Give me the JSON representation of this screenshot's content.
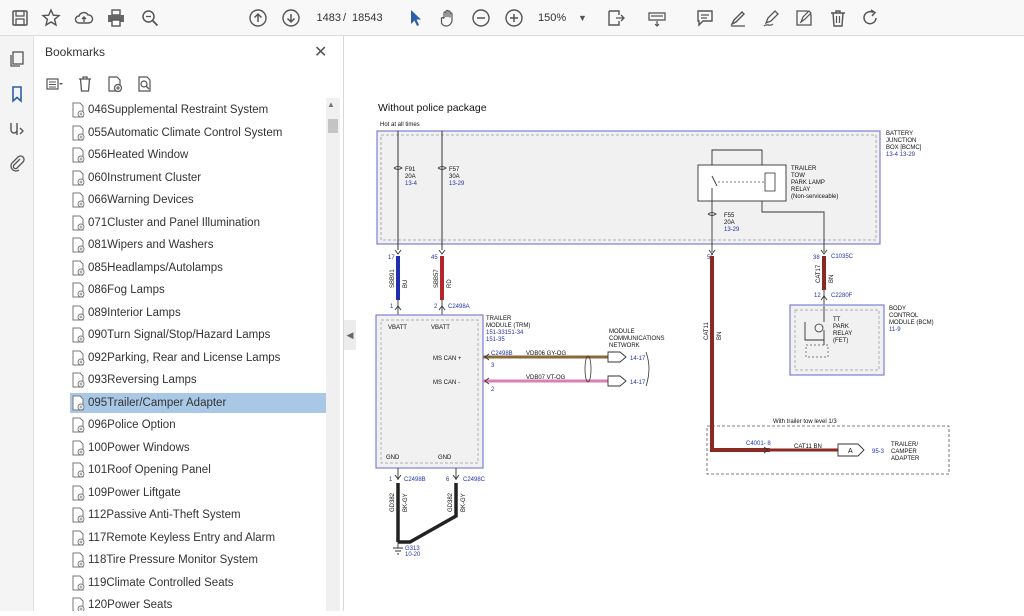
{
  "toolbar": {
    "page_current": "1483",
    "page_sep": "/",
    "page_total": "18543",
    "zoom": "150%"
  },
  "sidebar": {
    "title": "Bookmarks",
    "items": [
      {
        "label": "046Supplemental Restraint System"
      },
      {
        "label": "055Automatic Climate Control System"
      },
      {
        "label": "056Heated Window"
      },
      {
        "label": "060Instrument Cluster"
      },
      {
        "label": "066Warning Devices"
      },
      {
        "label": "071Cluster and Panel Illumination"
      },
      {
        "label": "081Wipers and Washers"
      },
      {
        "label": "085Headlamps/Autolamps"
      },
      {
        "label": "086Fog Lamps"
      },
      {
        "label": "089Interior Lamps"
      },
      {
        "label": "090Turn Signal/Stop/Hazard Lamps"
      },
      {
        "label": "092Parking, Rear and License Lamps"
      },
      {
        "label": "093Reversing Lamps"
      },
      {
        "label": "095Trailer/Camper Adapter",
        "selected": true
      },
      {
        "label": "096Police Option"
      },
      {
        "label": "100Power Windows"
      },
      {
        "label": "101Roof Opening Panel"
      },
      {
        "label": "109Power Liftgate"
      },
      {
        "label": "112Passive Anti-Theft System"
      },
      {
        "label": "117Remote Keyless Entry and Alarm"
      },
      {
        "label": "118Tire Pressure Monitor System"
      },
      {
        "label": "119Climate Controlled Seats"
      },
      {
        "label": "120Power Seats"
      }
    ]
  },
  "diagram": {
    "heading": "Without police package",
    "hot_label": "Hot at all times",
    "bjb": {
      "l1": "BATTERY",
      "l2": "JUNCTION",
      "l3": "BOX [BCMC]",
      "ref": "13-4   13-29"
    },
    "f91": {
      "name": "F91",
      "amp": "20A",
      "ref": "13-4"
    },
    "f57": {
      "name": "F57",
      "amp": "30A",
      "ref": "13-29"
    },
    "f55": {
      "name": "F55",
      "amp": "20A",
      "ref": "13-29"
    },
    "relay": {
      "l1": "TRAILER",
      "l2": "TOW",
      "l3": "PARK LAMP",
      "l4": "RELAY",
      "l5": "(Non-serviceable)"
    },
    "pin17": "17",
    "pin45": "45",
    "pin55": "55",
    "pin38": "38",
    "w1": {
      "circuit": "SBB91",
      "color": "BU"
    },
    "w2": {
      "circuit": "SBB57",
      "color": "RD"
    },
    "w3": {
      "circuit": "CAT11",
      "color": "BN"
    },
    "w4": {
      "circuit": "CAT17",
      "color": "BN"
    },
    "pin1": "1",
    "pin2": "2",
    "pin12": "12",
    "c2498a": "C2498A",
    "c1035c": "C1035C",
    "c2280f": "C2280F",
    "trm": {
      "l1": "TRAILER",
      "l2": "MODULE (TRM)",
      "l3": "151-33151-34",
      "l4": "151-35",
      "vbatt1": "VBATT",
      "vbatt2": "VBATT",
      "canp": "MS CAN +",
      "cann": "MS CAN -",
      "gnd1": "GND",
      "gnd2": "GND"
    },
    "mcn": {
      "l1": "MODULE",
      "l2": "COMMUNICATIONS",
      "l3": "NETWORK"
    },
    "c2498b_top": "C2498B",
    "pin3": "3",
    "pin2b": "2",
    "vdb06": "VDB06  GY-OG",
    "vdb07": "VDB07  VT-OG",
    "ref1417a": "14-17",
    "ref1417b": "14-17",
    "bcm": {
      "l1": "BODY",
      "l2": "CONTROL",
      "l3": "MODULE (BCM)",
      "l4": "11-9",
      "relay1": "TT",
      "relay2": "PARK",
      "relay3": "RELAY",
      "relay4": "(FET)"
    },
    "tow": {
      "title": "With trailer tow level 1/3",
      "c4001": "C4001- 8",
      "wire": "CAT11  BN",
      "a": "A",
      "ref": "95-3",
      "l1": "TRAILER/",
      "l2": "CAMPER",
      "l3": "ADAPTER"
    },
    "gnd": {
      "pin1": "1",
      "pin6": "6",
      "c2498b": "C2498B",
      "c2498c": "C2498C",
      "w1": "GD382",
      "w1c": "BK-GY",
      "w2": "GD382",
      "w2c": "BK-GY",
      "g313": "G313",
      "gref": "10-20"
    }
  },
  "colors": {
    "accent": "#2b5fa8",
    "selected": "#a9c8e6",
    "wire_blue": "#1f2fb0",
    "wire_red": "#b3262b",
    "wire_brown": "#8a2a22",
    "wire_pink": "#d77fb6",
    "ref_blue": "#2233aa"
  }
}
